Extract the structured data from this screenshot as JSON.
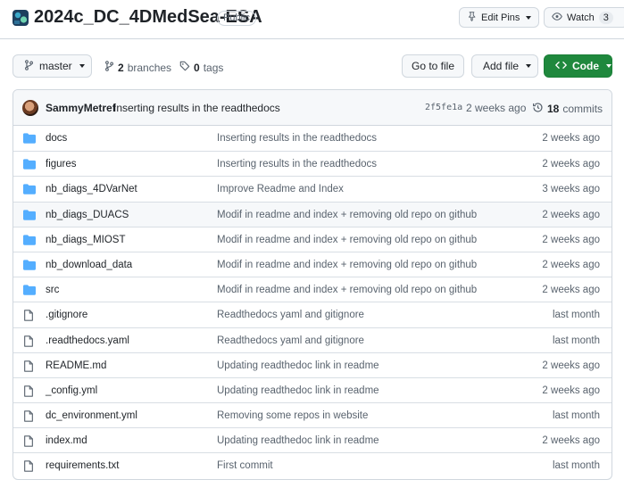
{
  "repo": {
    "name": "2024c_DC_4DMedSea-ESA",
    "visibility": "Public",
    "edit_pins_label": "Edit Pins",
    "watch_label": "Watch",
    "watch_count": "3"
  },
  "toolbar": {
    "branch_name": "master",
    "branches_count": "2",
    "branches_label": "branches",
    "tags_count": "0",
    "tags_label": "tags",
    "go_to_file_label": "Go to file",
    "add_file_label": "Add file",
    "code_label": "Code"
  },
  "latest_commit": {
    "author": "SammyMetref",
    "message": "Inserting results in the readthedocs",
    "sha": "2f5fe1a",
    "when": "2 weeks ago",
    "count": "18",
    "count_label": "commits"
  },
  "files": [
    {
      "type": "dir",
      "name": "docs",
      "message": "Inserting results in the readthedocs",
      "when": "2 weeks ago"
    },
    {
      "type": "dir",
      "name": "figures",
      "message": "Inserting results in the readthedocs",
      "when": "2 weeks ago"
    },
    {
      "type": "dir",
      "name": "nb_diags_4DVarNet",
      "message": "Improve Readme and Index",
      "when": "3 weeks ago"
    },
    {
      "type": "dir",
      "name": "nb_diags_DUACS",
      "message": "Modif in readme and index + removing old repo on github",
      "when": "2 weeks ago"
    },
    {
      "type": "dir",
      "name": "nb_diags_MIOST",
      "message": "Modif in readme and index + removing old repo on github",
      "when": "2 weeks ago"
    },
    {
      "type": "dir",
      "name": "nb_download_data",
      "message": "Modif in readme and index + removing old repo on github",
      "when": "2 weeks ago"
    },
    {
      "type": "dir",
      "name": "src",
      "message": "Modif in readme and index + removing old repo on github",
      "when": "2 weeks ago"
    },
    {
      "type": "file",
      "name": ".gitignore",
      "message": "Readthedocs yaml and gitignore",
      "when": "last month"
    },
    {
      "type": "file",
      "name": ".readthedocs.yaml",
      "message": "Readthedocs yaml and gitignore",
      "when": "last month"
    },
    {
      "type": "file",
      "name": "README.md",
      "message": "Updating readthedoc link in readme",
      "when": "2 weeks ago"
    },
    {
      "type": "file",
      "name": "_config.yml",
      "message": "Updating readthedoc link in readme",
      "when": "2 weeks ago"
    },
    {
      "type": "file",
      "name": "dc_environment.yml",
      "message": "Removing some repos in website",
      "when": "last month"
    },
    {
      "type": "file",
      "name": "index.md",
      "message": "Updating readthedoc link in readme",
      "when": "2 weeks ago"
    },
    {
      "type": "file",
      "name": "requirements.txt",
      "message": "First commit",
      "when": "last month"
    }
  ],
  "colors": {
    "folder": "#54aeff",
    "green_button": "#1f883d",
    "border": "#d0d7de",
    "muted_text": "#59636e"
  }
}
